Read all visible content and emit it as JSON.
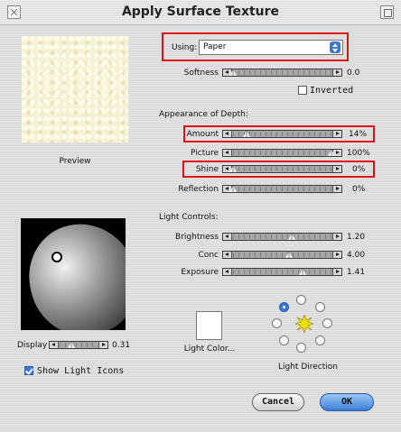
{
  "window": {
    "title": "Apply Surface Texture"
  },
  "preview": {
    "label": "Preview"
  },
  "using": {
    "label": "Using:",
    "value": "Paper"
  },
  "softness": {
    "label": "Softness",
    "value": "0.0",
    "level": 0.0
  },
  "inverted": {
    "label": "Inverted",
    "checked": false
  },
  "depth": {
    "heading": "Appearance of Depth:",
    "amount": {
      "label": "Amount",
      "value": "14%",
      "level": 0.14
    },
    "picture": {
      "label": "Picture",
      "value": "100%",
      "level": 1.0
    },
    "shine": {
      "label": "Shine",
      "value": "0%",
      "level": 0.0
    },
    "reflection": {
      "label": "Reflection",
      "value": "0%",
      "level": 0.0
    }
  },
  "light_controls": {
    "heading": "Light Controls:",
    "brightness": {
      "label": "Brightness",
      "value": "1.20",
      "level": 0.6
    },
    "conc": {
      "label": "Conc",
      "value": "4.00",
      "level": 0.57
    },
    "exposure": {
      "label": "Exposure",
      "value": "1.41",
      "level": 0.71
    }
  },
  "display": {
    "label": "Display",
    "value": "0.31",
    "level": 0.31
  },
  "show_light_icons": {
    "label": "Show Light Icons",
    "checked": true
  },
  "light_color": {
    "label": "Light Color...",
    "color": "#ffffff"
  },
  "light_direction": {
    "label": "Light Direction"
  },
  "buttons": {
    "cancel": "Cancel",
    "ok": "OK"
  },
  "colors": {
    "highlight": "#e0101a",
    "accent": "#3a77d8"
  }
}
